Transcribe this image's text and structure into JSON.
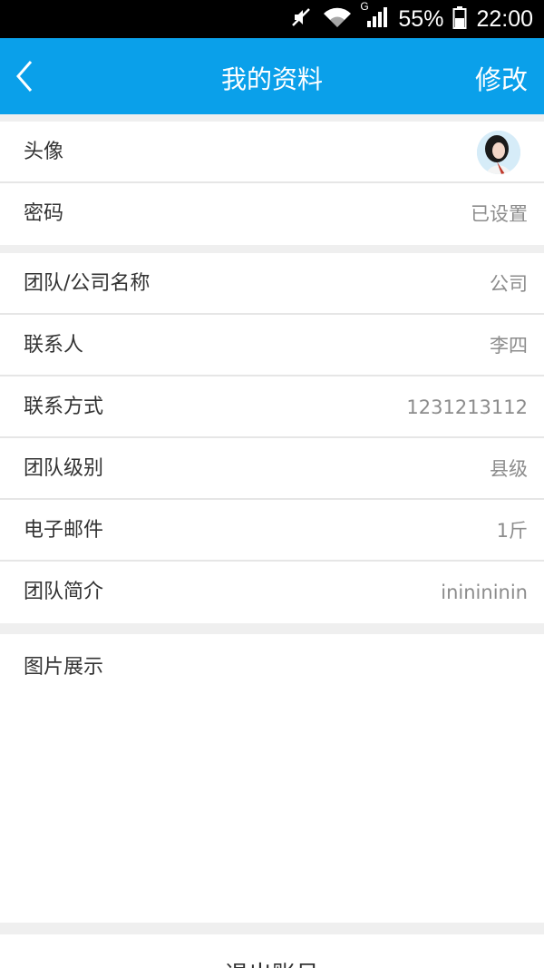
{
  "status_bar": {
    "battery": "55%",
    "time": "22:00",
    "network_label": "G",
    "icons": [
      "mute-icon",
      "wifi-icon",
      "signal-icon",
      "battery-icon"
    ]
  },
  "header": {
    "title": "我的资料",
    "edit_label": "修改",
    "back_icon": "chevron-left-icon"
  },
  "profile": {
    "avatar": {
      "label": "头像"
    },
    "password": {
      "label": "密码",
      "value": "已设置"
    }
  },
  "details": [
    {
      "label": "团队/公司名称",
      "value": "公司"
    },
    {
      "label": "联系人",
      "value": "李四"
    },
    {
      "label": "联系方式",
      "value": "1231213112"
    },
    {
      "label": "团队级别",
      "value": "县级"
    },
    {
      "label": "电子邮件",
      "value": "1斤"
    },
    {
      "label": "团队简介",
      "value": "ininininin"
    }
  ],
  "gallery": {
    "label": "图片展示"
  },
  "logout": {
    "label": "退出账号"
  },
  "colors": {
    "primary": "#0aa0ea",
    "background": "#efefef",
    "text": "#333333",
    "muted": "#8c8c8c"
  }
}
